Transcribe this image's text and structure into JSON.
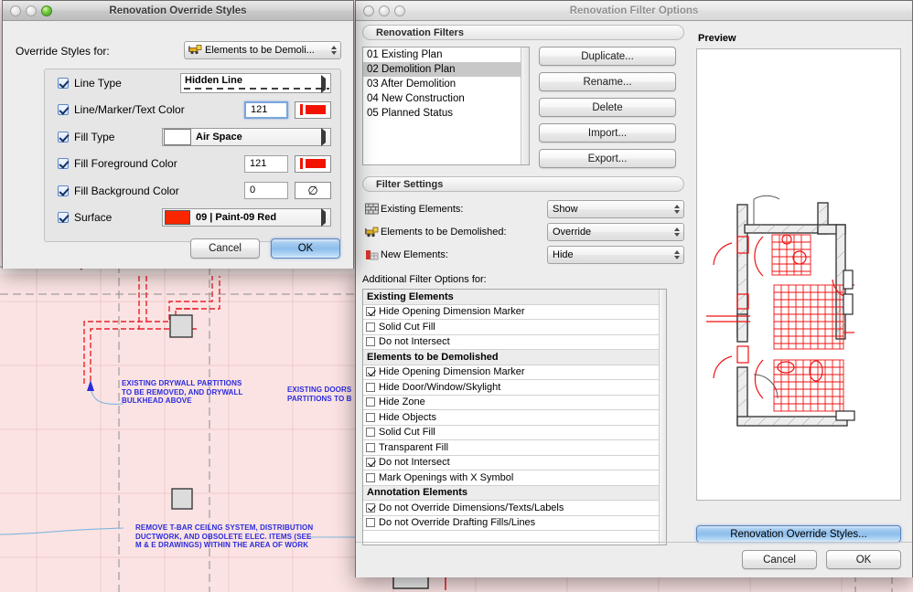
{
  "background": {
    "annotations": [
      {
        "id": "anno-drywall",
        "text": "EXISTING DRYWALL PARTITIONS\nTO BE REMOVED, AND DRYWALL\nBULKHEAD ABOVE"
      },
      {
        "id": "anno-doors",
        "text": "EXISTING DOORS\nPARTITIONS TO B"
      },
      {
        "id": "anno-ceiling",
        "text": "REMOVE T-BAR CEILNG SYSTEM, DISTRIBUTION\nDUCTWORK, AND OBSOLETE ELEC. ITEMS (SEE\nM & E DRAWINGS) WITHIN THE AREA OF WORK"
      }
    ],
    "colors": {
      "plan_fill": "#fbe0e0",
      "demo_red": "#e8232a",
      "grid": "#9a9a9a",
      "anno_blue": "#2b2bdd"
    }
  },
  "override_dialog": {
    "title": "Renovation Override Styles",
    "label_for": "Override Styles for:",
    "target_popup": {
      "value": "Elements to be Demoli...",
      "icon": "bulldozer-icon"
    },
    "rows": [
      {
        "id": "line-type",
        "label": "Line Type",
        "checked": true,
        "control": "popup-linetype",
        "value": "Hidden Line"
      },
      {
        "id": "line-color",
        "label": "Line/Marker/Text Color",
        "checked": true,
        "control": "color-field",
        "value": "121",
        "focused": true
      },
      {
        "id": "fill-type",
        "label": "Fill Type",
        "checked": true,
        "control": "popup-fill",
        "value": "Air Space"
      },
      {
        "id": "fill-fg-color",
        "label": "Fill Foreground Color",
        "checked": true,
        "control": "color-field",
        "value": "121",
        "focused": false
      },
      {
        "id": "fill-bg-color",
        "label": "Fill Background Color",
        "checked": true,
        "control": "empty-field",
        "value": "0"
      },
      {
        "id": "surface",
        "label": "Surface",
        "checked": true,
        "control": "popup-surface",
        "value": "09 | Paint-09 Red"
      }
    ],
    "buttons": {
      "cancel": "Cancel",
      "ok": "OK"
    },
    "colors": {
      "swatch_red": "#f11300",
      "surface_red": "#fa2600"
    }
  },
  "filter_dialog": {
    "title": "Renovation Filter Options",
    "filters_group_label": "Renovation Filters",
    "filters": [
      {
        "label": "01 Existing Plan",
        "selected": false
      },
      {
        "label": "02 Demolition Plan",
        "selected": true
      },
      {
        "label": "03 After Demolition",
        "selected": false
      },
      {
        "label": "04 New Construction",
        "selected": false
      },
      {
        "label": "05 Planned Status",
        "selected": false
      }
    ],
    "side_buttons": [
      "Duplicate...",
      "Rename...",
      "Delete",
      "Import...",
      "Export..."
    ],
    "settings_group_label": "Filter Settings",
    "settings": [
      {
        "icon": "brick-wall-icon",
        "label": "Existing Elements:",
        "value": "Show"
      },
      {
        "icon": "bulldozer-icon",
        "label": "Elements to be Demolished:",
        "value": "Override"
      },
      {
        "icon": "new-element-icon",
        "label": "New Elements:",
        "value": "Hide"
      }
    ],
    "additional_label": "Additional Filter Options for:",
    "options": [
      {
        "type": "header",
        "label": "Existing Elements"
      },
      {
        "type": "checkbox",
        "label": "Hide Opening Dimension Marker",
        "checked": true
      },
      {
        "type": "checkbox",
        "label": "Solid Cut Fill",
        "checked": false
      },
      {
        "type": "checkbox",
        "label": "Do not Intersect",
        "checked": false
      },
      {
        "type": "header",
        "label": "Elements to be Demolished"
      },
      {
        "type": "checkbox",
        "label": "Hide Opening Dimension Marker",
        "checked": true
      },
      {
        "type": "checkbox",
        "label": "Hide Door/Window/Skylight",
        "checked": false
      },
      {
        "type": "checkbox",
        "label": "Hide Zone",
        "checked": false
      },
      {
        "type": "checkbox",
        "label": "Hide Objects",
        "checked": false
      },
      {
        "type": "checkbox",
        "label": "Solid Cut Fill",
        "checked": false
      },
      {
        "type": "checkbox",
        "label": "Transparent Fill",
        "checked": false
      },
      {
        "type": "checkbox",
        "label": "Do not Intersect",
        "checked": true
      },
      {
        "type": "checkbox",
        "label": "Mark Openings with X Symbol",
        "checked": false
      },
      {
        "type": "header",
        "label": "Annotation Elements"
      },
      {
        "type": "checkbox",
        "label": "Do not Override Dimensions/Texts/Labels",
        "checked": true
      },
      {
        "type": "checkbox",
        "label": "Do not Override Drafting Fills/Lines",
        "checked": false
      }
    ],
    "preview_label": "Preview",
    "override_styles_button": "Renovation Override Styles...",
    "buttons": {
      "cancel": "Cancel",
      "ok": "OK"
    }
  }
}
